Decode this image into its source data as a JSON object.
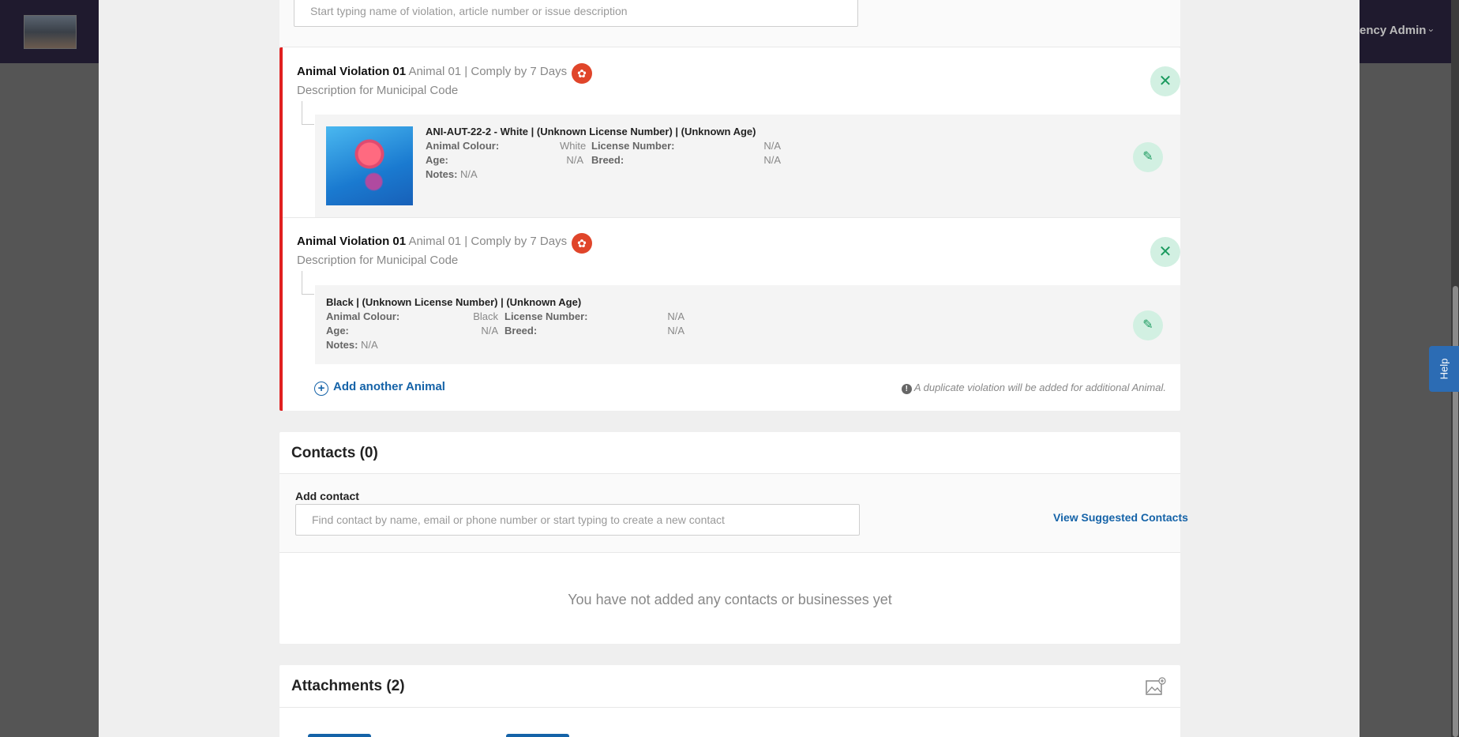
{
  "header": {
    "user_label": "ency Admin"
  },
  "violation_search": {
    "placeholder": "Start typing name of violation, article number or issue description"
  },
  "violations": [
    {
      "title": "Animal Violation 01",
      "meta": "Animal 01 | Comply by 7 Days",
      "description": "Description for Municipal Code",
      "animal": {
        "name": "ANI-AUT-22-2 - White | (Unknown License Number) | (Unknown Age)",
        "colour_label": "Animal Colour:",
        "colour": "White",
        "license_label": "License Number:",
        "license": "N/A",
        "age_label": "Age:",
        "age": "N/A",
        "breed_label": "Breed:",
        "breed": "N/A",
        "notes_label": "Notes:",
        "notes": "N/A",
        "has_photo": true
      }
    },
    {
      "title": "Animal Violation 01",
      "meta": "Animal 01 | Comply by 7 Days",
      "description": "Description for Municipal Code",
      "animal": {
        "name": "Black | (Unknown License Number) | (Unknown Age)",
        "colour_label": "Animal Colour:",
        "colour": "Black",
        "license_label": "License Number:",
        "license": "N/A",
        "age_label": "Age:",
        "age": "N/A",
        "breed_label": "Breed:",
        "breed": "N/A",
        "notes_label": "Notes:",
        "notes": "N/A",
        "has_photo": false
      }
    }
  ],
  "add_animal": {
    "label": "Add another Animal",
    "note": "A duplicate violation will be added for additional Animal."
  },
  "contacts": {
    "title": "Contacts (0)",
    "add_label": "Add contact",
    "placeholder": "Find contact by name, email or phone number or start typing to create a new contact",
    "suggested_link": "View Suggested Contacts",
    "empty_text": "You have not added any contacts or businesses yet"
  },
  "attachments": {
    "title": "Attachments (2)"
  },
  "help": {
    "label": "Help"
  },
  "colors": {
    "accent": "#1563a8",
    "violation_bar": "#e02020",
    "success": "#1a9a5e",
    "paw": "#e0452a"
  }
}
